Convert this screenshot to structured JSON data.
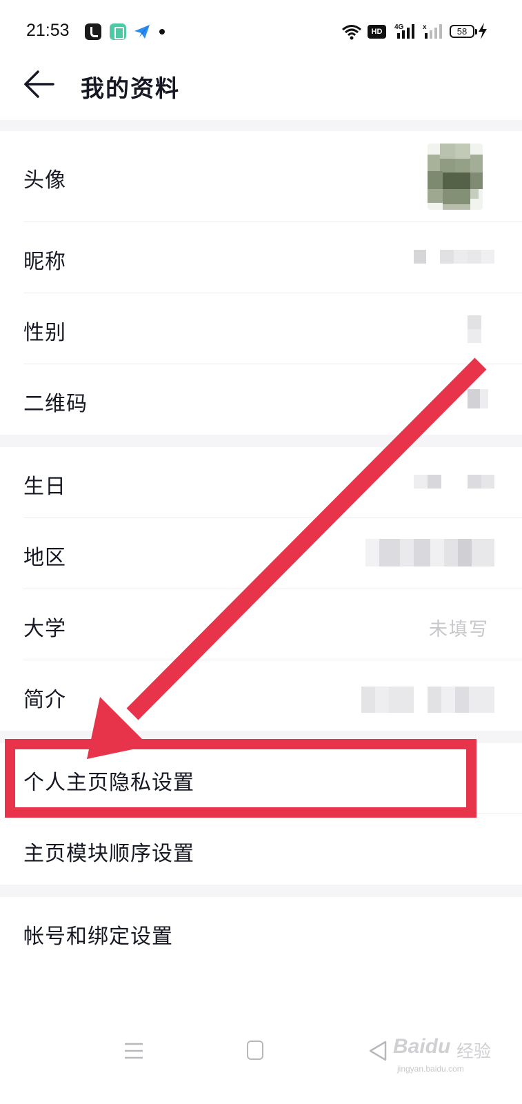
{
  "status_bar": {
    "time": "21:53",
    "hd_label": "HD",
    "network_label": "4G",
    "battery_level": "58",
    "icons": [
      "tiktok-icon",
      "green-app-icon",
      "telegram-icon",
      "notification-dot",
      "wifi-icon",
      "signal-icon",
      "battery-icon",
      "charging-icon"
    ]
  },
  "header": {
    "title": "我的资料",
    "back_icon": "arrow-left-icon"
  },
  "profile_rows": [
    {
      "label": "头像",
      "value_type": "avatar"
    },
    {
      "label": "昵称",
      "value_type": "blurred"
    },
    {
      "label": "性别",
      "value_type": "blurred"
    },
    {
      "label": "二维码",
      "value_type": "blurred"
    }
  ],
  "detail_rows": [
    {
      "label": "生日",
      "value_type": "blurred"
    },
    {
      "label": "地区",
      "value_type": "blurred"
    },
    {
      "label": "大学",
      "value": "未填写"
    },
    {
      "label": "简介",
      "value_type": "blurred"
    }
  ],
  "settings_rows": [
    {
      "label": "个人主页隐私设置",
      "highlighted": true
    },
    {
      "label": "主页模块顺序设置"
    }
  ],
  "account_rows": [
    {
      "label": "帐号和绑定设置"
    }
  ],
  "annotation": {
    "color": "#e8344a"
  },
  "nav_bar": {
    "icons": [
      "menu-icon",
      "home-icon",
      "back-triangle-icon"
    ]
  },
  "watermark": {
    "logo": "Baidu",
    "suffix": "经验",
    "url": "jingyan.baidu.com"
  },
  "colors": {
    "background": "#ffffff",
    "section_gap": "#f5f5f7",
    "text_primary": "#161823",
    "text_placeholder": "#c8c8cc",
    "highlight": "#e8344a"
  }
}
